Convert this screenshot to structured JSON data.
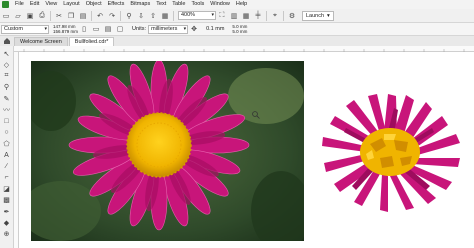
{
  "menu": [
    "File",
    "Edit",
    "View",
    "Layout",
    "Object",
    "Effects",
    "Bitmaps",
    "Text",
    "Table",
    "Tools",
    "Window",
    "Help"
  ],
  "toolbar": {
    "zoom": "400%",
    "launch": "Launch",
    "icons": [
      "new-document-icon",
      "open-icon",
      "save-icon",
      "print-icon",
      "cut-icon",
      "copy-icon",
      "paste-icon",
      "undo-icon",
      "redo-icon",
      "search-icon",
      "import-icon",
      "export-icon",
      "zoom-icon"
    ]
  },
  "property_bar": {
    "preset": "Custom",
    "width": "147.98 mm",
    "height": "156.879 mm",
    "units_label": "Units:",
    "units": "millimeters",
    "nudge": "0.1 mm",
    "dup_x": "5.0 mm",
    "dup_y": "5.0 mm"
  },
  "tabs": [
    {
      "label": "Welcome Screen",
      "active": false
    },
    {
      "label": "Bullfolied.cdr*",
      "active": true
    }
  ],
  "colors": {
    "petal": "#c8157a",
    "center": "#f0b400",
    "foliage": "#2f4a2a"
  }
}
